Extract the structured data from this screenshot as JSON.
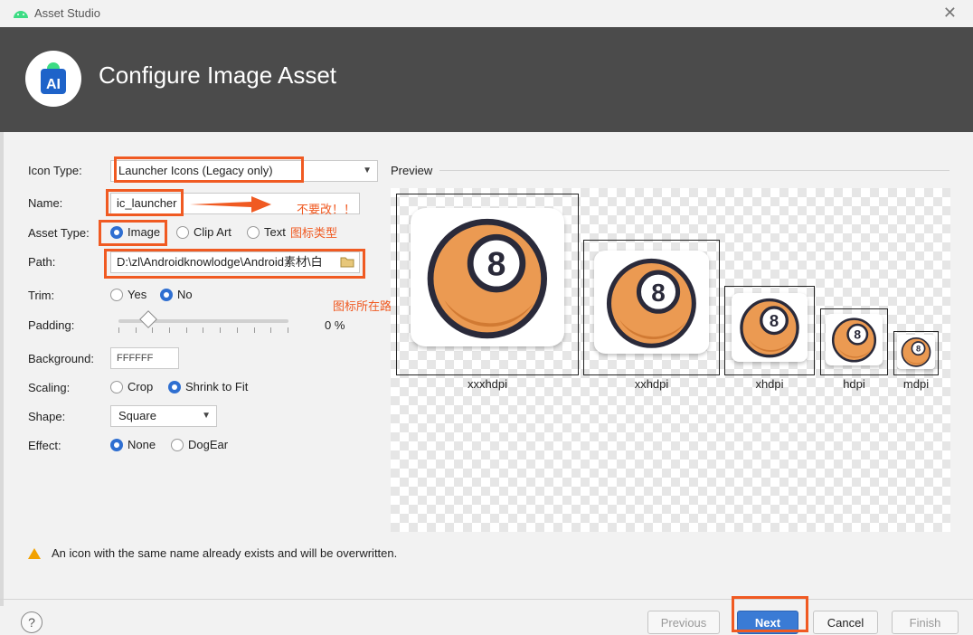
{
  "window": {
    "title": "Asset Studio",
    "close_glyph": "✕"
  },
  "header": {
    "title": "Configure Image Asset"
  },
  "form": {
    "icon_type": {
      "label": "Icon Type:",
      "value": "Launcher Icons (Legacy only)"
    },
    "name": {
      "label": "Name:",
      "value": "ic_launcher"
    },
    "asset_type": {
      "label": "Asset Type:",
      "options": [
        "Image",
        "Clip Art",
        "Text"
      ],
      "selected": "Image"
    },
    "path": {
      "label": "Path:",
      "value": "D:\\zl\\Androidknowlodge\\Android素材\\白"
    },
    "trim": {
      "label": "Trim:",
      "options": [
        "Yes",
        "No"
      ],
      "selected": "No"
    },
    "padding": {
      "label": "Padding:",
      "value": "0 %",
      "fraction": 0.18
    },
    "background": {
      "label": "Background:",
      "value": "FFFFFF"
    },
    "scaling": {
      "label": "Scaling:",
      "options": [
        "Crop",
        "Shrink to Fit"
      ],
      "selected": "Shrink to Fit"
    },
    "shape": {
      "label": "Shape:",
      "value": "Square"
    },
    "effect": {
      "label": "Effect:",
      "options": [
        "None",
        "DogEar"
      ],
      "selected": "None"
    }
  },
  "annotations": {
    "name_note": "不要改！！",
    "asset_type_note": "图标类型",
    "path_note": "图标所在路径"
  },
  "preview": {
    "label": "Preview",
    "densities": [
      "xxxhdpi",
      "xxhdpi",
      "xhdpi",
      "hdpi",
      "mdpi"
    ],
    "icon_glyph": "8"
  },
  "warning": {
    "text": "An icon with the same name already exists and will be overwritten."
  },
  "footer": {
    "help": "?",
    "previous": "Previous",
    "next": "Next",
    "cancel": "Cancel",
    "finish": "Finish"
  },
  "colors": {
    "accent": "#f05a22",
    "primary_button": "#3a7bd5",
    "header_bg": "#4b4b4b",
    "ball": "#eb9a52"
  }
}
